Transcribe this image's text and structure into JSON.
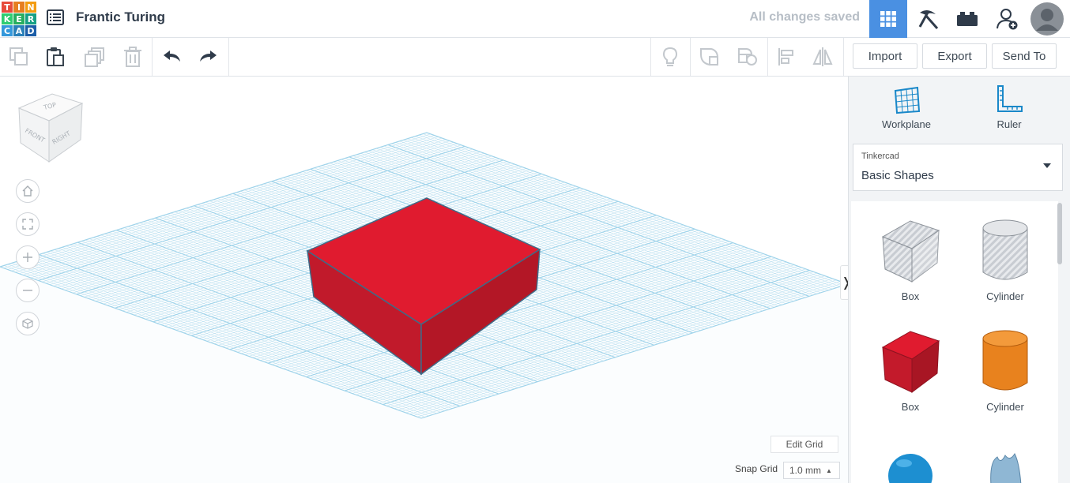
{
  "app": {
    "logo_letters": [
      "T",
      "I",
      "N",
      "K",
      "E",
      "R",
      "C",
      "A",
      "D"
    ],
    "logo_colors": [
      "#e74c3c",
      "#e67e22",
      "#f39c12",
      "#2ecc71",
      "#27ae60",
      "#16a085",
      "#3498db",
      "#2980b9",
      "#1c5ea8"
    ],
    "project_title": "Frantic Turing",
    "save_status": "All changes saved"
  },
  "header": {
    "buttons": [
      "grid-view-icon",
      "pickaxe-icon",
      "bricks-icon",
      "add-user-icon",
      "avatar"
    ],
    "accent": "#4a90e2"
  },
  "toolbar": {
    "import_label": "Import",
    "export_label": "Export",
    "sendto_label": "Send To"
  },
  "viewcube": {
    "top": "TOP",
    "front": "FRONT",
    "right": "RIGHT"
  },
  "canvas": {
    "shape_color": "#d91c2c",
    "grid_color": "#9fd3ea",
    "edit_grid_label": "Edit Grid",
    "snap_grid_label": "Snap Grid",
    "snap_grid_value": "1.0 mm"
  },
  "panel": {
    "workplane_label": "Workplane",
    "ruler_label": "Ruler",
    "library_source": "Tinkercad",
    "library_name": "Basic Shapes",
    "shapes": [
      {
        "label": "Box",
        "kind": "hole-box"
      },
      {
        "label": "Cylinder",
        "kind": "hole-cylinder"
      },
      {
        "label": "Box",
        "kind": "box",
        "color": "#d91c2c"
      },
      {
        "label": "Cylinder",
        "kind": "cylinder",
        "color": "#e8821e"
      }
    ]
  }
}
